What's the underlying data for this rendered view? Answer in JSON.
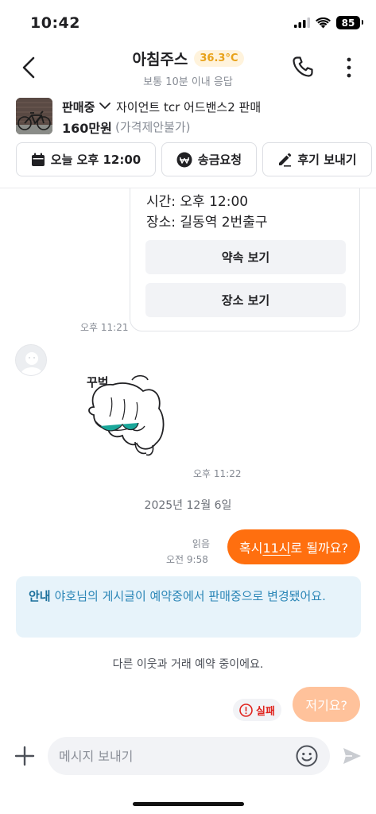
{
  "status_bar": {
    "time": "10:42",
    "battery": "85"
  },
  "header": {
    "title": "아침주스",
    "temperature": "36.3°C",
    "subtitle": "보통 10분 이내 응답",
    "colors": {
      "temp_text": "#e8a21a",
      "temp_bg": "#fff3dc"
    }
  },
  "product": {
    "status": "판매중",
    "title": "자이언트 tcr 어드밴스2 판매",
    "price": "160만원",
    "price_note": "(가격제안불가)"
  },
  "actions": [
    {
      "label": "오늘 오후 12:00",
      "icon": "calendar-icon"
    },
    {
      "label": "송금요청",
      "icon": "won-pay-icon"
    },
    {
      "label": "후기 보내기",
      "icon": "pencil-icon"
    }
  ],
  "chat": {
    "appointment": {
      "time_line": "시간: 오후 12:00",
      "place_line": "장소: 길동역 2번출구",
      "view_appt_button": "약속 보기",
      "view_place_button": "장소 보기",
      "timestamp": "오후 11:21"
    },
    "sticker": {
      "caption": "꾸벅",
      "timestamp": "오후 11:22"
    },
    "date_separator": "2025년 12월 6일",
    "my_message": {
      "prefix": "혹시 ",
      "highlight": "11시",
      "suffix": "로 될까요?",
      "read_status": "읽음",
      "timestamp": "오전 9:58"
    },
    "notice": {
      "label": "안내",
      "text": "야호님의 게시글이 예약중에서 판매중으로 변경됐어요."
    },
    "system_message": "다른 이웃과 거래 예약 중이에요.",
    "failed_message": {
      "text": "저기요?",
      "fail_label": "실패"
    }
  },
  "input": {
    "placeholder": "메시지 보내기"
  },
  "colors": {
    "brand": "#ff6f0f",
    "brand_faded": "#ffc29b",
    "fail": "#e0241e"
  }
}
